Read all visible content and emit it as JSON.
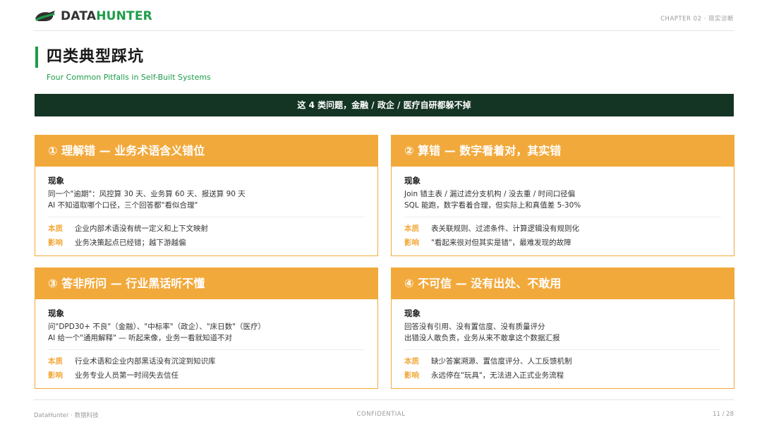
{
  "header": {
    "logo_text_a": "DATA",
    "logo_text_b": "HUNTER",
    "chapter": "CHAPTER 02 · 现实诊断"
  },
  "title": {
    "main": "四类典型踩坑",
    "sub": "Four Common Pitfalls in Self-Built Systems"
  },
  "banner": "这 4 类问题，金融 / 政企 / 医疗自研都躲不掉",
  "labels": {
    "phenomenon": "现象",
    "essence": "本质",
    "impact": "影响"
  },
  "cards": [
    {
      "title": "① 理解错 — 业务术语含义错位",
      "lines": [
        "同一个\"逾期\"：风控算 30 天、业务算 60 天、报送算 90 天",
        "AI 不知道取哪个口径，三个回答都\"看似合理\""
      ],
      "essence": "企业内部术语没有统一定义和上下文映射",
      "impact": "业务决策起点已经错；越下游越偏"
    },
    {
      "title": "② 算错 — 数字看着对，其实错",
      "lines": [
        "Join 错主表 / 漏过滤分支机构 / 没去重 / 时间口径偏",
        "SQL 能跑，数字看着合理，但实际上和真值差 5-30%"
      ],
      "essence": "表关联规则、过滤条件、计算逻辑没有规则化",
      "impact": "\"看起来很对但其实是错\"，最难发现的故障"
    },
    {
      "title": "③ 答非所问 — 行业黑话听不懂",
      "lines": [
        "问\"DPD30+ 不良\"（金融）、\"中标率\"（政企）、\"床日数\"（医疗）",
        "AI 给一个\"通用解释\" — 听起来像，业务一看就知道不对"
      ],
      "essence": "行业术语和企业内部黑话没有沉淀到知识库",
      "impact": "业务专业人员第一时间失去信任"
    },
    {
      "title": "④ 不可信 — 没有出处、不敢用",
      "lines": [
        "回答没有引用、没有置信度、没有质量评分",
        "出错没人敢负责，业务从来不敢拿这个数据汇报"
      ],
      "essence": "缺少答案溯源、置信度评分、人工反馈机制",
      "impact": "永远停在\"玩具\"，无法进入正式业务流程"
    }
  ],
  "footer": {
    "left": "DataHunter · 数猎科技",
    "center": "CONFIDENTIAL",
    "right": "11 / 28"
  },
  "colors": {
    "brand_green": "#1e9c4a",
    "accent_orange": "#f2a93b",
    "banner_dark": "#143424"
  }
}
